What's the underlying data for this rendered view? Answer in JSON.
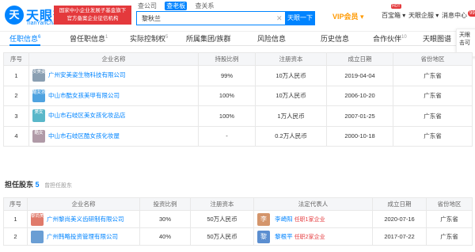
{
  "header": {
    "logo_mark": "天",
    "logo_text": "天眼查",
    "logo_sub": "TianYanCha.com",
    "banner_line1": "国家中小企业发展子基金旗下",
    "banner_line2": "官方备案企业征信机构",
    "search_tabs": [
      "查公司",
      "查老板",
      "查关系"
    ],
    "search_value": "黎秋兰",
    "search_button": "天眼一下",
    "vip_label": "VIP会员",
    "nav": [
      "百宝箱",
      "天眼企服",
      "消息中心"
    ],
    "hot_badge": "HOT",
    "msg_count": "99+"
  },
  "tabs": [
    {
      "label": "任职信息",
      "count": "6"
    },
    {
      "label": "曾任职信息",
      "count": "1"
    },
    {
      "label": "实际控制权",
      "count": "5"
    },
    {
      "label": "所属集团/族群",
      "count": ""
    },
    {
      "label": "风险信息",
      "count": ""
    },
    {
      "label": "历史信息",
      "count": ""
    },
    {
      "label": "合作伙伴",
      "count": "10"
    },
    {
      "label": "天眼图谱",
      "count": ""
    }
  ],
  "side_panel": {
    "line1": "天眼",
    "line2": "击可"
  },
  "table1": {
    "headers": [
      "序号",
      "企业名称",
      "持股比例",
      "注册资本",
      "成立日期",
      "省份地区"
    ],
    "rows": [
      {
        "no": "1",
        "logo": "安美姿",
        "logo_color": "#8a9fb2",
        "name": "广州安美姿生物科技有限公司",
        "ratio": "99%",
        "capital": "10万人民币",
        "date": "2019-04-04",
        "region": "广东省"
      },
      {
        "no": "2",
        "logo": "酷女孩",
        "logo_color": "#4fa3e0",
        "name": "中山市酷女孩美甲有限公司",
        "ratio": "100%",
        "capital": "10万人民币",
        "date": "2006-10-20",
        "region": "广东省"
      },
      {
        "no": "3",
        "logo": "美女",
        "logo_color": "#59b7c9",
        "name": "中山市石岐区美女孩化妆品店",
        "ratio": "100%",
        "capital": "1万人民币",
        "date": "2007-01-25",
        "region": "广东省"
      },
      {
        "no": "4",
        "logo": "酷女",
        "logo_color": "#b09aa7",
        "name": "中山市石岐区酷女孩化妆屋",
        "ratio": "-",
        "capital": "0.2万人民币",
        "date": "2000-10-18",
        "region": "广东省"
      }
    ]
  },
  "section2": {
    "title": "担任股东",
    "count": "5",
    "sub": "曾担任股东"
  },
  "table2": {
    "headers": [
      "序号",
      "企业名称",
      "投资比例",
      "注册资本",
      "法定代表人",
      "成立日期",
      "省份地区"
    ],
    "rows": [
      {
        "no": "1",
        "logo": "黎尚美",
        "logo_color": "#e07a6a",
        "name": "广州黎尚美义齿研制有限公司",
        "ratio": "30%",
        "capital": "50万人民币",
        "rep_avatar": "李",
        "rep_color": "#d4956b",
        "rep": "李崎阳",
        "related": "任职1家企业",
        "date": "2020-07-16",
        "region": "广东省"
      },
      {
        "no": "2",
        "logo": "",
        "logo_color": "#6a9ed4",
        "name": "广州韩略投资管理有限公司",
        "ratio": "40%",
        "capital": "50万人民币",
        "rep_avatar": "黎",
        "rep_color": "#5b8ed0",
        "rep": "黎根平",
        "related": "任职2家企业",
        "date": "2017-07-22",
        "region": "广东省"
      }
    ]
  }
}
